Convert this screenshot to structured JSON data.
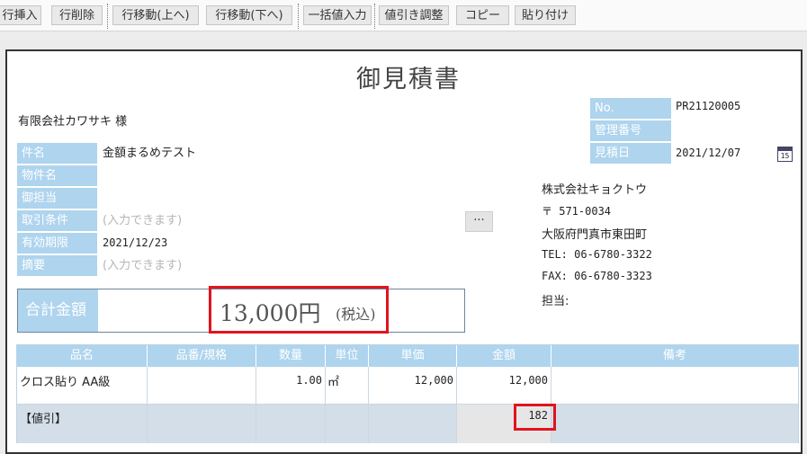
{
  "toolbar": {
    "insert_row": "行挿入",
    "delete_row": "行削除",
    "move_up": "行移動(上へ)",
    "move_down": "行移動(下へ)",
    "bulk_input": "一括値入力",
    "discount_adjust": "値引き調整",
    "copy": "コピー",
    "paste": "貼り付け"
  },
  "document": {
    "title": "御見積書",
    "client": "有限会社カワサキ 様"
  },
  "fields": {
    "subject_label": "件名",
    "subject_value": "金額まるめテスト",
    "property_label": "物件名",
    "contact_label": "御担当",
    "terms_label": "取引条件",
    "terms_placeholder": "(入力できます)",
    "validity_label": "有効期限",
    "validity_value": "2021/12/23",
    "summary_label": "摘要",
    "summary_placeholder": "(入力できます)"
  },
  "info": {
    "no_label": "No.",
    "no_value": "PR21120005",
    "mgmt_label": "管理番号",
    "mgmt_value": "",
    "date_label": "見積日",
    "date_value": "2021/12/07",
    "calendar_day": "15",
    "ellipsis": "···"
  },
  "company": {
    "name": "株式会社キョクトウ",
    "postal": "〒 571-0034",
    "address": "大阪府門真市東田町",
    "tel": "TEL: 06-6780-3322",
    "fax": "FAX: 06-6780-3323",
    "person": "担当:"
  },
  "total": {
    "label": "合計金額",
    "amount": "13,000円",
    "tax_note": "(税込)"
  },
  "table": {
    "headers": [
      "品名",
      "品番/規格",
      "数量",
      "単位",
      "単価",
      "金額",
      "備考"
    ],
    "rows": [
      {
        "name": "クロス貼り AA級",
        "spec": "",
        "qty": "1.00",
        "unit": "㎡",
        "price": "12,000",
        "amount": "12,000",
        "note": ""
      },
      {
        "name": "【値引】",
        "spec": "",
        "qty": "",
        "unit": "",
        "price": "",
        "amount": "182",
        "note": ""
      }
    ]
  },
  "colors": {
    "label_bg": "#aed4ee",
    "highlight": "#e0141e",
    "discount_row": "#d3dee8"
  }
}
